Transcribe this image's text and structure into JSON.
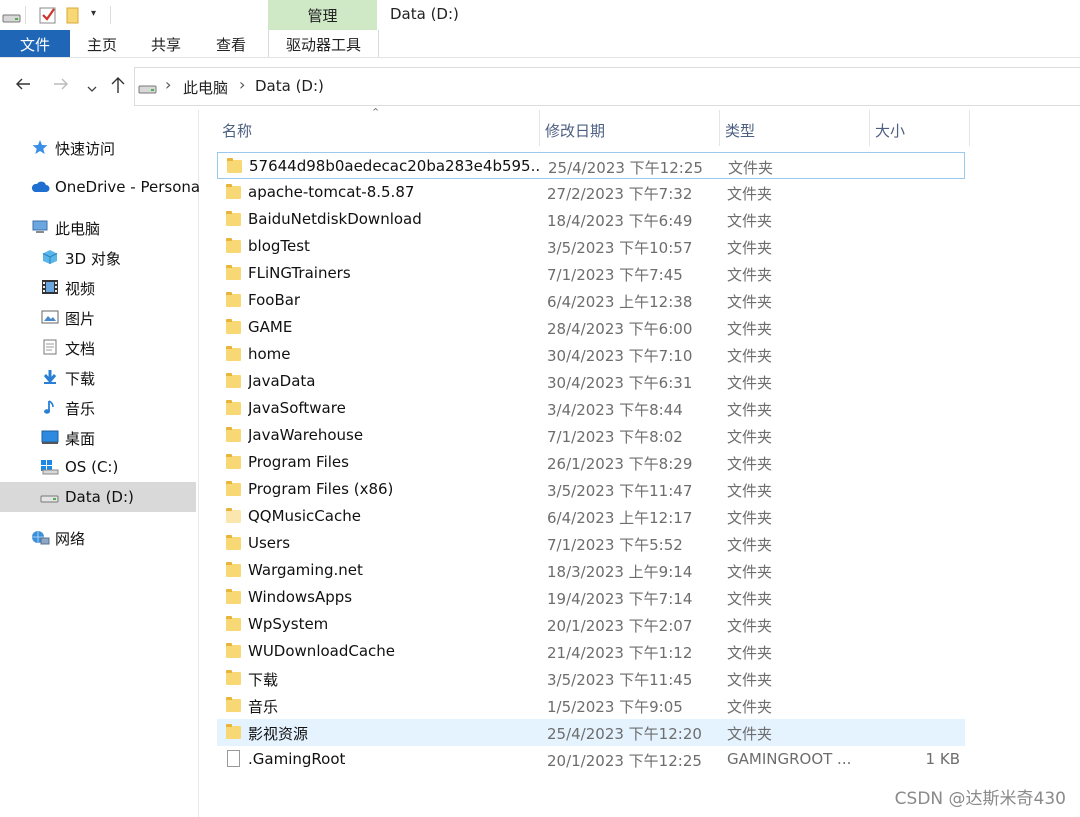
{
  "window": {
    "title": "Data (D:)",
    "context_tab_label": "管理"
  },
  "ribbon": {
    "tabs": [
      {
        "label": "文件"
      },
      {
        "label": "主页"
      },
      {
        "label": "共享"
      },
      {
        "label": "查看"
      },
      {
        "label": "驱动器工具"
      }
    ]
  },
  "navigation": {
    "breadcrumb": [
      "此电脑",
      "Data (D:)"
    ]
  },
  "sidebar": {
    "items": [
      {
        "label": "快速访问",
        "icon": "star-icon"
      },
      {
        "label": "OneDrive - Persona",
        "icon": "cloud-icon"
      },
      {
        "label": "此电脑",
        "icon": "computer-icon"
      },
      {
        "label": "3D 对象",
        "icon": "cube-icon"
      },
      {
        "label": "视频",
        "icon": "film-icon"
      },
      {
        "label": "图片",
        "icon": "picture-icon"
      },
      {
        "label": "文档",
        "icon": "document-icon"
      },
      {
        "label": "下载",
        "icon": "download-arrow-icon"
      },
      {
        "label": "音乐",
        "icon": "music-note-icon"
      },
      {
        "label": "桌面",
        "icon": "desktop-icon"
      },
      {
        "label": "OS (C:)",
        "icon": "windows-drive-icon"
      },
      {
        "label": "Data (D:)",
        "icon": "drive-icon",
        "selected": true
      },
      {
        "label": "网络",
        "icon": "network-icon"
      }
    ]
  },
  "file_list": {
    "columns": [
      "名称",
      "修改日期",
      "类型",
      "大小"
    ],
    "rows": [
      {
        "name": "57644d98b0aedecac20ba283e4b595...",
        "date": "25/4/2023 下午12:25",
        "type": "文件夹",
        "size": "",
        "icon": "folder-icon",
        "state": "focused"
      },
      {
        "name": "apache-tomcat-8.5.87",
        "date": "27/2/2023 下午7:32",
        "type": "文件夹",
        "size": "",
        "icon": "folder-icon"
      },
      {
        "name": "BaiduNetdiskDownload",
        "date": "18/4/2023 下午6:49",
        "type": "文件夹",
        "size": "",
        "icon": "folder-icon"
      },
      {
        "name": "blogTest",
        "date": "3/5/2023 下午10:57",
        "type": "文件夹",
        "size": "",
        "icon": "folder-icon"
      },
      {
        "name": "FLiNGTrainers",
        "date": "7/1/2023 下午7:45",
        "type": "文件夹",
        "size": "",
        "icon": "folder-icon"
      },
      {
        "name": "FooBar",
        "date": "6/4/2023 上午12:38",
        "type": "文件夹",
        "size": "",
        "icon": "folder-icon"
      },
      {
        "name": "GAME",
        "date": "28/4/2023 下午6:00",
        "type": "文件夹",
        "size": "",
        "icon": "folder-icon"
      },
      {
        "name": "home",
        "date": "30/4/2023 下午7:10",
        "type": "文件夹",
        "size": "",
        "icon": "folder-icon"
      },
      {
        "name": "JavaData",
        "date": "30/4/2023 下午6:31",
        "type": "文件夹",
        "size": "",
        "icon": "folder-icon"
      },
      {
        "name": "JavaSoftware",
        "date": "3/4/2023 下午8:44",
        "type": "文件夹",
        "size": "",
        "icon": "folder-icon"
      },
      {
        "name": "JavaWarehouse",
        "date": "7/1/2023 下午8:02",
        "type": "文件夹",
        "size": "",
        "icon": "folder-icon"
      },
      {
        "name": "Program Files",
        "date": "26/1/2023 下午8:29",
        "type": "文件夹",
        "size": "",
        "icon": "folder-icon"
      },
      {
        "name": "Program Files (x86)",
        "date": "3/5/2023 下午11:47",
        "type": "文件夹",
        "size": "",
        "icon": "folder-icon"
      },
      {
        "name": "QQMusicCache",
        "date": "6/4/2023 上午12:17",
        "type": "文件夹",
        "size": "",
        "icon": "folder-icon-faded"
      },
      {
        "name": "Users",
        "date": "7/1/2023 下午5:52",
        "type": "文件夹",
        "size": "",
        "icon": "folder-icon"
      },
      {
        "name": "Wargaming.net",
        "date": "18/3/2023 上午9:14",
        "type": "文件夹",
        "size": "",
        "icon": "folder-icon"
      },
      {
        "name": "WindowsApps",
        "date": "19/4/2023 下午7:14",
        "type": "文件夹",
        "size": "",
        "icon": "folder-icon"
      },
      {
        "name": "WpSystem",
        "date": "20/1/2023 下午2:07",
        "type": "文件夹",
        "size": "",
        "icon": "folder-icon"
      },
      {
        "name": "WUDownloadCache",
        "date": "21/4/2023 下午1:12",
        "type": "文件夹",
        "size": "",
        "icon": "folder-icon"
      },
      {
        "name": "下载",
        "date": "3/5/2023 下午11:45",
        "type": "文件夹",
        "size": "",
        "icon": "folder-icon"
      },
      {
        "name": "音乐",
        "date": "1/5/2023 下午9:05",
        "type": "文件夹",
        "size": "",
        "icon": "folder-icon"
      },
      {
        "name": "影视资源",
        "date": "25/4/2023 下午12:20",
        "type": "文件夹",
        "size": "",
        "icon": "folder-icon",
        "state": "hovered"
      },
      {
        "name": ".GamingRoot",
        "date": "20/1/2023 下午12:25",
        "type": "GAMINGROOT ...",
        "size": "1 KB",
        "icon": "file-icon"
      }
    ]
  },
  "watermark": "CSDN @达斯米奇430",
  "colors": {
    "file_tab": "#1f66b7",
    "context_tab": "#cfe8c6",
    "selected_nav": "#d9d9d9",
    "hover_row": "#e5f3ff",
    "focus_border": "#99c9ef",
    "folder": "#f8d775"
  }
}
